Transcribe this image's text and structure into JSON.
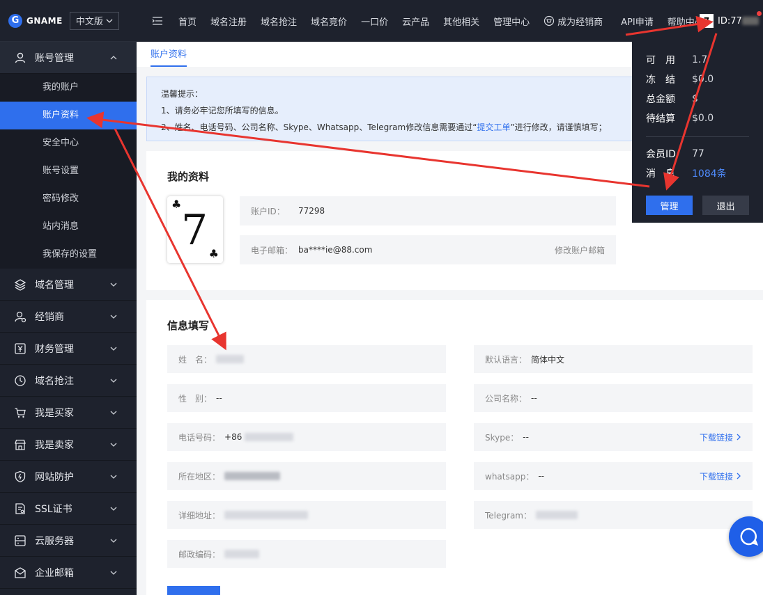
{
  "brand": {
    "logo_letter": "G",
    "logo_text": "GNAME",
    "lang": "中文版"
  },
  "topnav": {
    "items": [
      "首页",
      "域名注册",
      "域名抢注",
      "域名竞价",
      "一口价",
      "云产品",
      "其他相关",
      "管理中心"
    ],
    "dealer": "成为经销商",
    "api": "API申请",
    "help": "帮助中心",
    "user_avatar_char": "7",
    "user_id": "ID:77"
  },
  "sidebar": {
    "account_group": "账号管理",
    "sub_items": [
      "我的账户",
      "账户资料",
      "安全中心",
      "账号设置",
      "密码修改",
      "站内消息",
      "我保存的设置"
    ],
    "active_index": 1,
    "groups": [
      "域名管理",
      "经销商",
      "财务管理",
      "域名抢注",
      "我是买家",
      "我是卖家",
      "网站防护",
      "SSL证书",
      "云服务器",
      "企业邮箱"
    ]
  },
  "tab": {
    "label": "账户资料"
  },
  "notice": {
    "title": "温馨提示：",
    "line1": "1、请务必牢记您所填写的信息。",
    "line2_prefix": "2、姓名、电话号码、公司名称、Skype、Whatsapp、Telegram修改信息需要通过“",
    "line2_link": "提交工单",
    "line2_suffix": "”进行修改，请谨慎填写；"
  },
  "profile": {
    "title": "我的资料",
    "avatar_char": "7",
    "account_id_label": "账户ID：",
    "account_id": "77298",
    "email_label": "电子邮箱：",
    "email": "ba****ie@88.com",
    "email_action": "修改账户邮箱"
  },
  "info": {
    "title": "信息填写",
    "name_label": "姓　名：",
    "gender_label": "性　别：",
    "gender_value": "--",
    "phone_label": "电话号码：",
    "phone_prefix": "+86",
    "region_label": "所在地区：",
    "address_label": "详细地址：",
    "zip_label": "邮政编码：",
    "lang_label": "默认语言：",
    "lang_value": "简体中文",
    "company_label": "公司名称：",
    "company_value": "--",
    "skype_label": "Skype：",
    "skype_value": "--",
    "whatsapp_label": "whatsapp：",
    "whatsapp_value": "--",
    "telegram_label": "Telegram：",
    "download_link": "下载链接"
  },
  "dropdown": {
    "available_label": "可　用",
    "available_value": "1.7",
    "frozen_label": "冻　结",
    "frozen_value": "$0.0",
    "total_label": "总金额",
    "total_value": "$",
    "pending_label": "待结算",
    "pending_value": "$0.0",
    "member_label": "会员ID",
    "member_value": "77",
    "msg_label": "消　息",
    "msg_value": "1084条",
    "manage_btn": "管理",
    "logout_btn": "退出"
  },
  "colors": {
    "sidebar_bg": "#1e222d",
    "accent": "#2f6fed",
    "annotation_red": "#e8352f"
  }
}
